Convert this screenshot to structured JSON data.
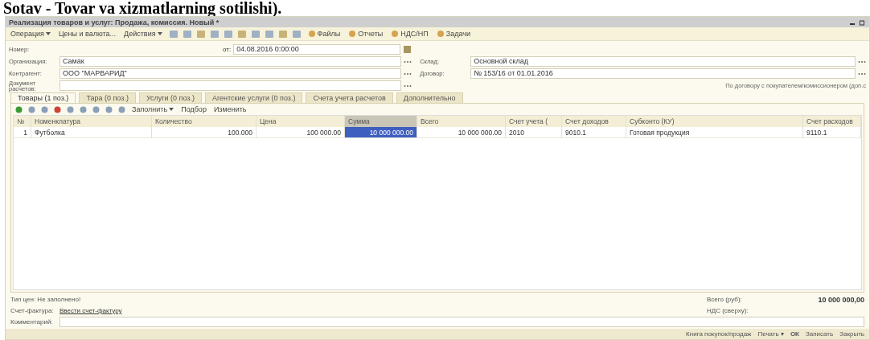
{
  "heading": "Sotav - Tovar va xizmatlarning sotilishi).",
  "window": {
    "title": "Реализация товаров и услуг: Продажа, комиссия. Новый *"
  },
  "toolbar": [
    {
      "kind": "menu",
      "label": "Операция"
    },
    {
      "kind": "text",
      "label": "Цены и валюта..."
    },
    {
      "kind": "menu",
      "label": "Действия"
    },
    {
      "kind": "icons"
    },
    {
      "kind": "icon-text",
      "label": "Файлы"
    },
    {
      "kind": "icon-text",
      "label": "Отчеты"
    },
    {
      "kind": "icon-text",
      "label": "НДС/НП"
    },
    {
      "kind": "icon-text",
      "label": "Задачи"
    }
  ],
  "form": {
    "number_label": "Номер:",
    "date_label": "от:",
    "date": "04.08.2016 0:00:00",
    "left": [
      {
        "label": "Организация:",
        "value": "Самак"
      },
      {
        "label": "Контрагент:",
        "value": "ООО \"МАРВАРИД\""
      },
      {
        "label": "Документ расчетов:"
      }
    ],
    "right": [
      {
        "label": "Склад:",
        "value": "Основной склад"
      },
      {
        "label": "Договор:",
        "value": "№ 153/16 от 01.01.2016"
      }
    ],
    "note": "По договору с покупателем/комиссионером (доп.с"
  },
  "tabs": [
    {
      "label": "Товары (1 поз.)",
      "selected": true
    },
    {
      "label": "Тара (0 поз.)",
      "selected": false
    },
    {
      "label": "Услуги (0 поз.)",
      "selected": false
    },
    {
      "label": "Агентские услуги (0 поз.)",
      "selected": false
    },
    {
      "label": "Счета учета расчетов",
      "selected": false
    },
    {
      "label": "Дополнительно",
      "selected": false
    }
  ],
  "table_toolbar": [
    {
      "label": "Заполнить",
      "menu": true
    },
    {
      "label": "Подбор",
      "menu": false
    },
    {
      "label": "Изменить",
      "menu": false
    }
  ],
  "table": {
    "columns": [
      {
        "label": "№",
        "selected": false
      },
      {
        "label": "Номенклатура",
        "selected": false
      },
      {
        "label": "Количество",
        "selected": false
      },
      {
        "label": "Цена",
        "selected": false
      },
      {
        "label": "Сумма",
        "selected": true
      },
      {
        "label": "Всего",
        "selected": false
      },
      {
        "label": "Счет учета (",
        "selected": false
      },
      {
        "label": "Счет доходов",
        "selected": false
      },
      {
        "label": "Субконто (КУ)",
        "selected": false
      },
      {
        "label": "Счет расходов",
        "selected": false
      }
    ],
    "rows": [
      {
        "cells": [
          {
            "text": "1",
            "selected": false
          },
          {
            "text": "Футболка",
            "selected": false
          },
          {
            "text": "100.000",
            "selected": false
          },
          {
            "text": "100 000.00",
            "selected": false
          },
          {
            "text": "10 000 000.00",
            "selected": true
          },
          {
            "text": "10 000 000.00",
            "selected": false
          },
          {
            "text": "2010",
            "selected": false
          },
          {
            "text": "9010.1",
            "selected": false
          },
          {
            "text": "Готовая продукция",
            "selected": false
          },
          {
            "text": "9110.1",
            "selected": false
          }
        ]
      }
    ]
  },
  "footer": {
    "price_type": "Тип цен: Не заполнено!",
    "invoice_label": "Счет-фактура:",
    "invoice_link": "Ввести счет-фактуру",
    "comment_label": "Комментарий:",
    "total_label": "Всего (руб):",
    "total": "10 000 000,00",
    "vat_label": "НДС (сверху):"
  },
  "status_bar": [
    {
      "label": "Книга покупок/продаж",
      "kind": "link"
    },
    {
      "label": "Печать ▾",
      "kind": "link"
    },
    {
      "label": "ОК",
      "kind": "bold"
    },
    {
      "label": "Записать",
      "kind": "link"
    },
    {
      "label": "Закрыть",
      "kind": "link"
    }
  ]
}
